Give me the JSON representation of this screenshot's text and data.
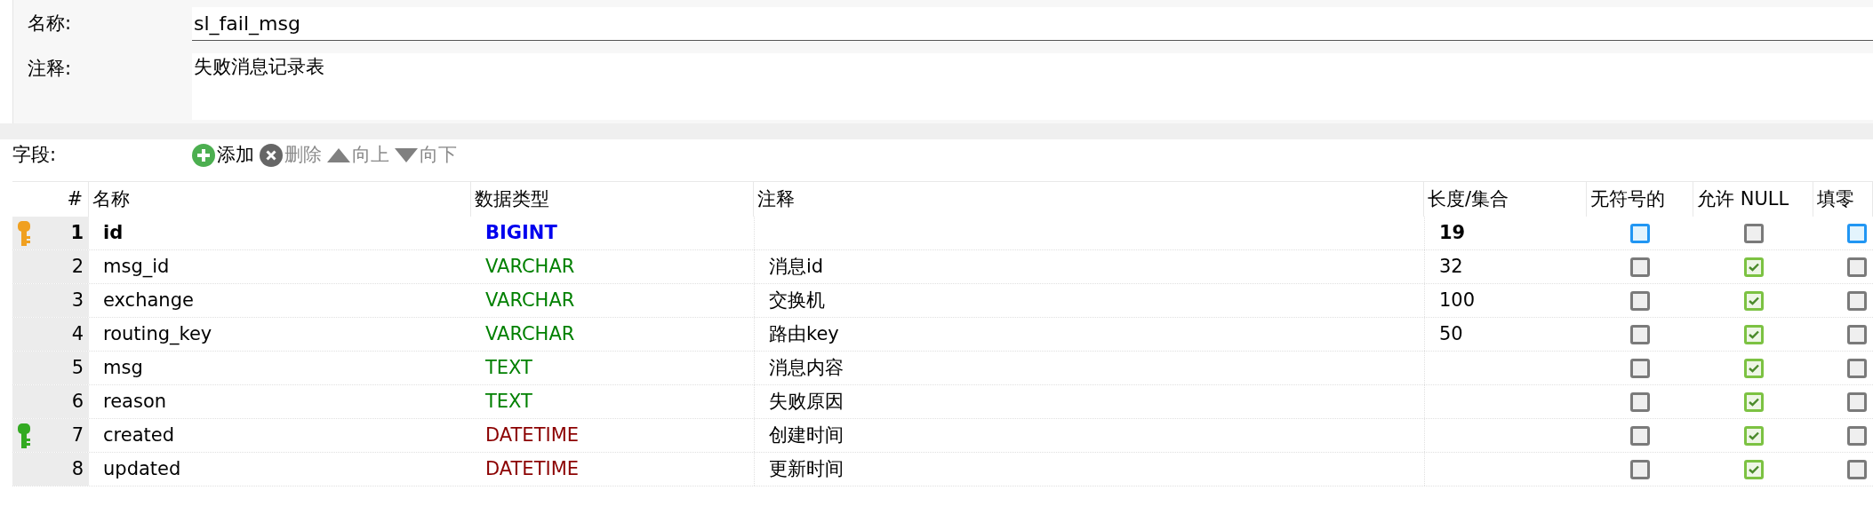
{
  "form": {
    "name_label": "名称:",
    "name_value": "sl_fail_msg",
    "comment_label": "注释:",
    "comment_value": "失败消息记录表"
  },
  "toolbar": {
    "label": "字段:",
    "buttons": [
      {
        "kind": "add",
        "label": "添加",
        "disabled": false
      },
      {
        "kind": "delete",
        "label": "删除",
        "disabled": true
      },
      {
        "kind": "up",
        "label": "向上",
        "disabled": true
      },
      {
        "kind": "down",
        "label": "向下",
        "disabled": true
      }
    ]
  },
  "table": {
    "columns": [
      "#",
      "名称",
      "数据类型",
      "注释",
      "长度/集合",
      "无符号的",
      "允许 NULL",
      "填零"
    ],
    "rows": [
      {
        "primary_key": true,
        "indexed": false,
        "num": "1",
        "name": "id",
        "type": "BIGINT",
        "kind": "integer",
        "comment": "",
        "length": "19",
        "unsigned": false,
        "allow_null": false,
        "zerofill": false
      },
      {
        "primary_key": false,
        "indexed": false,
        "num": "2",
        "name": "msg_id",
        "type": "VARCHAR",
        "kind": "string",
        "comment": "消息id",
        "length": "32",
        "unsigned": false,
        "allow_null": true,
        "zerofill": false
      },
      {
        "primary_key": false,
        "indexed": false,
        "num": "3",
        "name": "exchange",
        "type": "VARCHAR",
        "kind": "string",
        "comment": "交换机",
        "length": "100",
        "unsigned": false,
        "allow_null": true,
        "zerofill": false
      },
      {
        "primary_key": false,
        "indexed": false,
        "num": "4",
        "name": "routing_key",
        "type": "VARCHAR",
        "kind": "string",
        "comment": "路由key",
        "length": "50",
        "unsigned": false,
        "allow_null": true,
        "zerofill": false
      },
      {
        "primary_key": false,
        "indexed": false,
        "num": "5",
        "name": "msg",
        "type": "TEXT",
        "kind": "string",
        "comment": "消息内容",
        "length": "",
        "unsigned": false,
        "allow_null": true,
        "zerofill": false
      },
      {
        "primary_key": false,
        "indexed": false,
        "num": "6",
        "name": "reason",
        "type": "TEXT",
        "kind": "string",
        "comment": "失败原因",
        "length": "",
        "unsigned": false,
        "allow_null": true,
        "zerofill": false
      },
      {
        "primary_key": false,
        "indexed": true,
        "num": "7",
        "name": "created",
        "type": "DATETIME",
        "kind": "date",
        "comment": "创建时间",
        "length": "",
        "unsigned": false,
        "allow_null": true,
        "zerofill": false
      },
      {
        "primary_key": false,
        "indexed": false,
        "num": "8",
        "name": "updated",
        "type": "DATETIME",
        "kind": "date",
        "comment": "更新时间",
        "length": "",
        "unsigned": false,
        "allow_null": true,
        "zerofill": false
      }
    ]
  }
}
